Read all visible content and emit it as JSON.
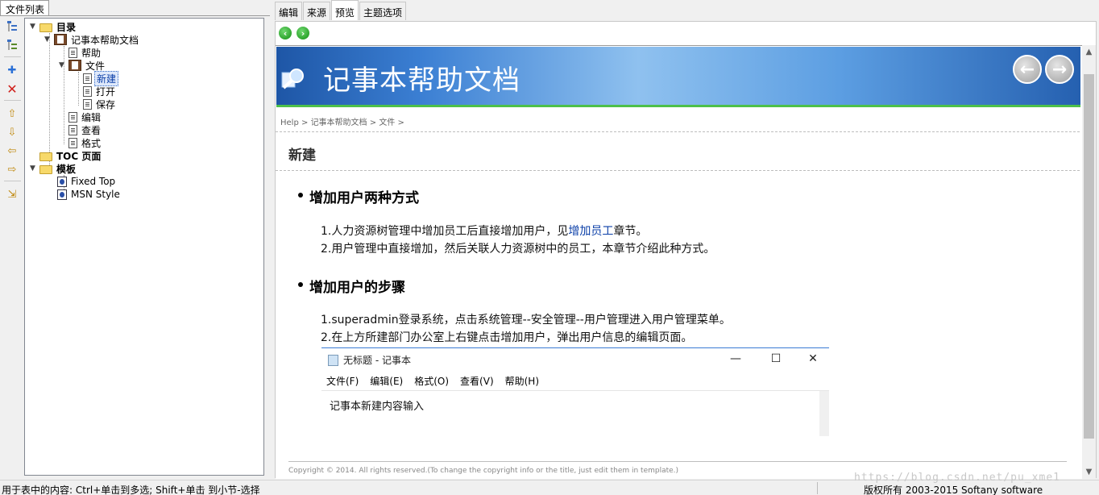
{
  "left_panel": {
    "tab_label": "文件列表",
    "tree": {
      "root": "目录",
      "doc": "记事本帮助文档",
      "help": "帮助",
      "file": "文件",
      "new": "新建",
      "open": "打开",
      "save": "保存",
      "edit": "编辑",
      "view": "查看",
      "format": "格式",
      "toc": "TOC 页面",
      "templates": "模板",
      "tpl_fixed": "Fixed Top",
      "tpl_msn": "MSN Style"
    },
    "toolbar_icons": [
      "collapse-tree-icon",
      "expand-tree-icon",
      "add-icon",
      "delete-icon",
      "move-up-icon",
      "move-down-icon",
      "move-left-icon",
      "move-right-icon",
      "insert-icon"
    ]
  },
  "tabs": [
    "编辑",
    "来源",
    "预览",
    "主题选项"
  ],
  "active_tab": "预览",
  "preview": {
    "banner_title": "记事本帮助文档",
    "breadcrumb": {
      "help": "Help",
      "sep": " > ",
      "doc": "记事本帮助文档",
      "file": "文件",
      "tail": " >"
    },
    "page_heading": "新建",
    "section1_title": "增加用户两种方式",
    "section1_line1_pre": "1.人力资源树管理中增加员工后直接增加用户，见",
    "section1_line1_link": "增加员工",
    "section1_line1_post": "章节。",
    "section1_line2": "2.用户管理中直接增加，然后关联人力资源树中的员工，本章节介绍此种方式。",
    "section2_title": "增加用户的步骤",
    "section2_line1": "1.superadmin登录系统，点击系统管理--安全管理--用户管理进入用户管理菜单。",
    "section2_line2": "2.在上方所建部门办公室上右键点击增加用户，弹出用户信息的编辑页面。",
    "notepad": {
      "title": "无标题 - 记事本",
      "menu": [
        "文件(F)",
        "编辑(E)",
        "格式(O)",
        "查看(V)",
        "帮助(H)"
      ],
      "content": "记事本新建内容输入"
    },
    "copyright": "Copyright © 2014. All rights reserved.(To change the copyright info or the title, just edit them in template.)"
  },
  "status": {
    "left": "用于表中的内容: Ctrl+单击到多选; Shift+单击 到小节-选择",
    "right": "版权所有 2003-2015 Softany software"
  },
  "watermark": "https://blog.csdn.net/pu_xme1",
  "colors": {
    "banner_dark": "#1e56a6",
    "banner_light": "#8fc1ef",
    "banner_rule": "#4dc04a",
    "link": "#0b3fa8"
  }
}
